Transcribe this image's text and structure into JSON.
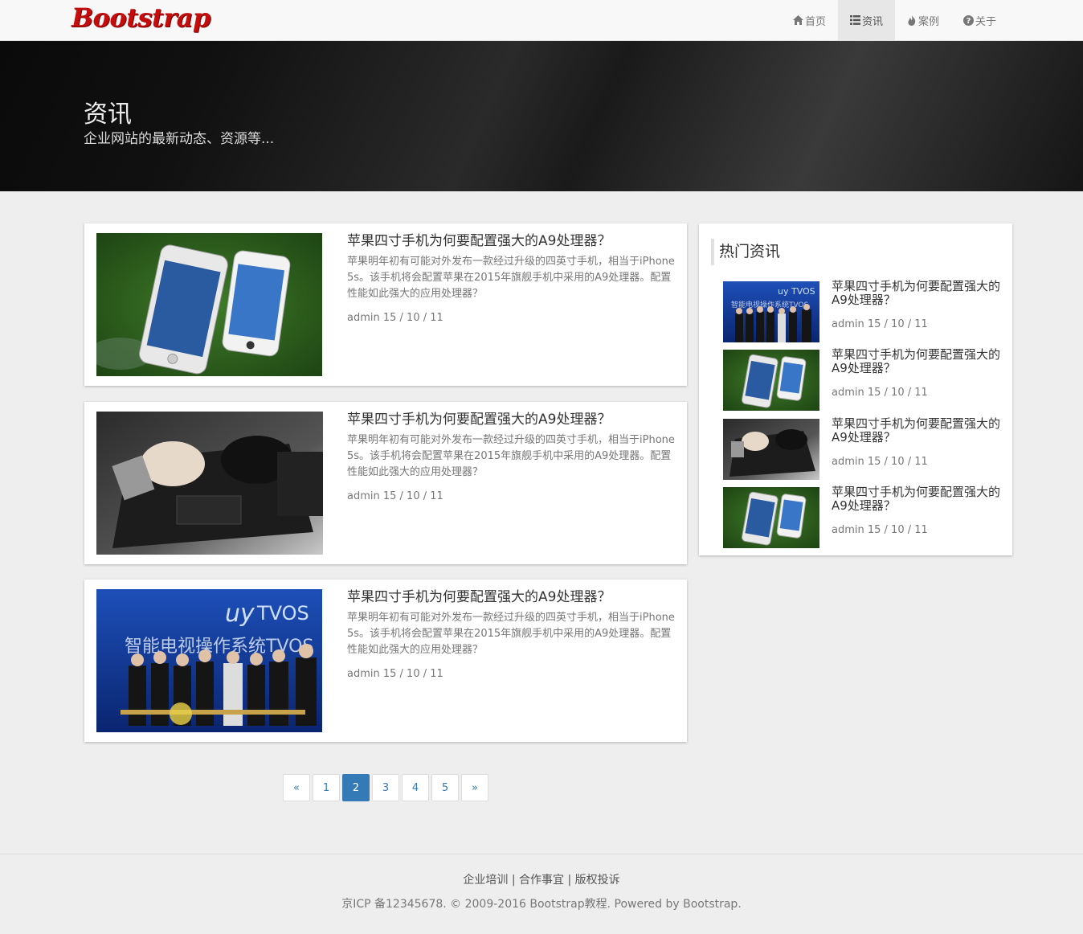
{
  "navbar": {
    "brand": "Bootstrap",
    "items": [
      {
        "label": "首页",
        "icon": "home-icon"
      },
      {
        "label": "资讯",
        "icon": "list-icon",
        "active": true
      },
      {
        "label": "案例",
        "icon": "fire-icon"
      },
      {
        "label": "关于",
        "icon": "question-circle-icon"
      }
    ]
  },
  "banner": {
    "title": "资讯",
    "subtitle": "企业网站的最新动态、资源等..."
  },
  "articles": [
    {
      "title": "苹果四寸手机为何要配置强大的A9处理器？",
      "desc": "苹果明年初有可能对外发布一款经过升级的四英寸手机，相当于iPhone 5s。该手机将会配置苹果在2015年旗舰手机中采用的A9处理器。配置性能如此强大的应用处理器？",
      "meta": "admin 15 / 10 / 11",
      "image": "iphones-on-grass"
    },
    {
      "title": "苹果四寸手机为何要配置强大的A9处理器？",
      "desc": "苹果明年初有可能对外发布一款经过升级的四英寸手机，相当于iPhone 5s。该手机将会配置苹果在2015年旗舰手机中采用的A9处理器。配置性能如此强大的应用处理器？",
      "meta": "admin 15 / 10 / 11",
      "image": "hands-on-keyboard"
    },
    {
      "title": "苹果四寸手机为何要配置强大的A9处理器？",
      "desc": "苹果明年初有可能对外发布一款经过升级的四英寸手机，相当于iPhone 5s。该手机将会配置苹果在2015年旗舰手机中采用的A9处理器。配置性能如此强大的应用处理器？",
      "meta": "admin 15 / 10 / 11",
      "image": "tvos-launch-event"
    }
  ],
  "sidebar": {
    "heading": "热门资讯",
    "items": [
      {
        "title": "苹果四寸手机为何要配置强大的A9处理器？",
        "meta": "admin 15 / 10 / 11",
        "image": "tvos-launch-event"
      },
      {
        "title": "苹果四寸手机为何要配置强大的A9处理器？",
        "meta": "admin 15 / 10 / 11",
        "image": "iphones-on-grass"
      },
      {
        "title": "苹果四寸手机为何要配置强大的A9处理器？",
        "meta": "admin 15 / 10 / 11",
        "image": "hands-on-keyboard"
      },
      {
        "title": "苹果四寸手机为何要配置强大的A9处理器？",
        "meta": "admin 15 / 10 / 11",
        "image": "iphones-on-grass"
      }
    ]
  },
  "pagination": {
    "prev": "«",
    "pages": [
      "1",
      "2",
      "3",
      "4",
      "5"
    ],
    "active": "2",
    "next": "»"
  },
  "footer": {
    "links": [
      "企业培训",
      "合作事宜",
      "版权投诉"
    ],
    "separator": "|",
    "copyright": "京ICP 备12345678. © 2009-2016 Bootstrap教程. Powered by Bootstrap."
  },
  "colors": {
    "brand": "#c40d0d",
    "link": "#337ab7",
    "background": "#eeeeee"
  }
}
